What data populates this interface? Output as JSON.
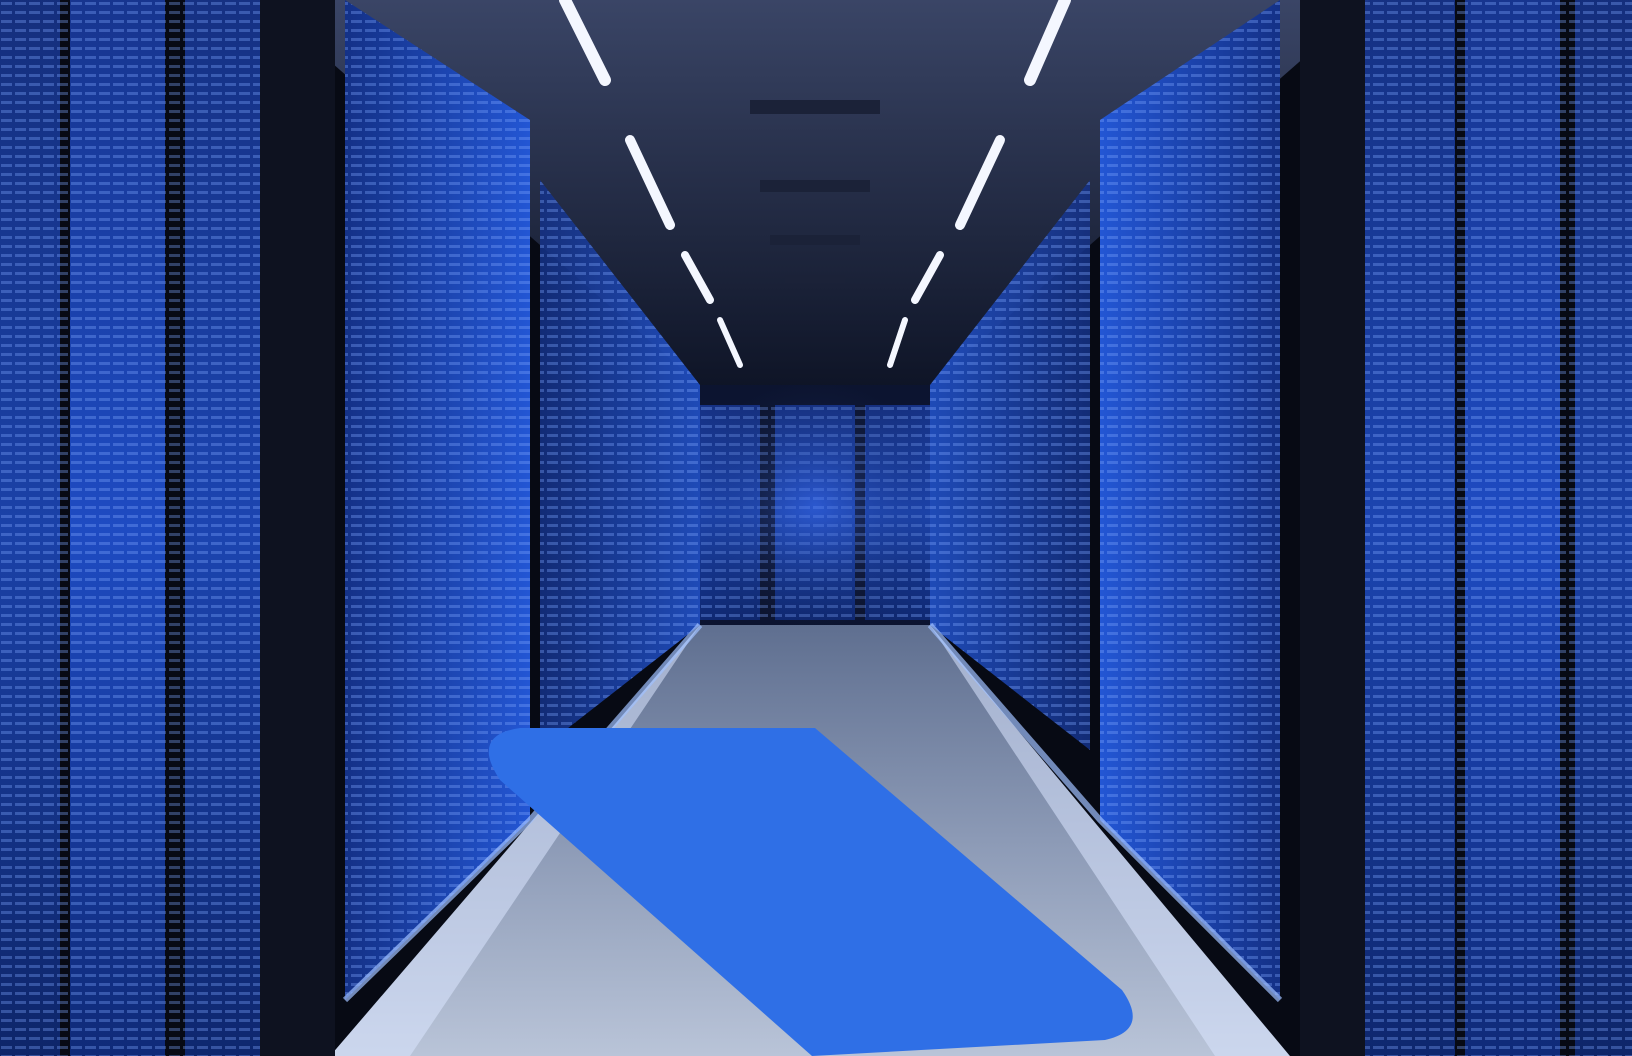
{
  "scene": {
    "subject": "server-room-aisle",
    "colors": {
      "background": "#0a0d18",
      "rack_glow": "#1f56d6",
      "rack_dark": "#0b1226",
      "floor_light": "#c9d6ee",
      "accent_shape": "#2f6fe6",
      "ceiling": "#2a3450"
    }
  }
}
